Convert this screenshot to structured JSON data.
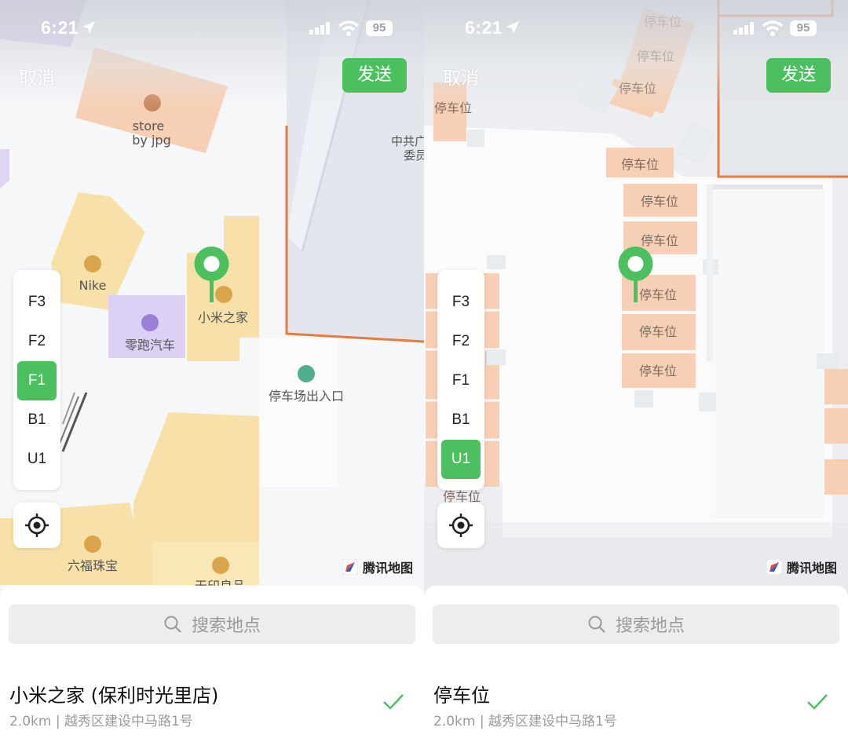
{
  "status": {
    "time": "6:21",
    "battery": "95"
  },
  "nav": {
    "cancel_label": "取消",
    "send_label": "发送"
  },
  "floors": [
    "F3",
    "F2",
    "F1",
    "B1",
    "U1"
  ],
  "brand": "腾讯地图",
  "search": {
    "placeholder": "搜索地点"
  },
  "colors": {
    "accent": "#4cbf5e",
    "shop": "#f7e1a8",
    "parking": "#f7cfb4",
    "ev": "#d9cdf3",
    "road": "#e97a3a"
  },
  "screens": [
    {
      "active_floor": "F1",
      "map_labels": {
        "store": "store",
        "store_sub": "by jpg",
        "nike": "Nike",
        "ev": "零跑汽车",
        "xiaomi": "小米之家",
        "parking_exit": "停车场出入口",
        "zhonggong": "中共广",
        "weiyuan": "委员",
        "jewelry": "六福珠宝",
        "muji": "无印良品"
      },
      "result": {
        "title": "小米之家 (保利时光里店)",
        "subtitle": "2.0km | 越秀区建设中马路1号"
      }
    },
    {
      "active_floor": "U1",
      "map_labels": {
        "parking": "停车位"
      },
      "result": {
        "title": "停车位",
        "subtitle": "2.0km | 越秀区建设中马路1号"
      }
    }
  ]
}
